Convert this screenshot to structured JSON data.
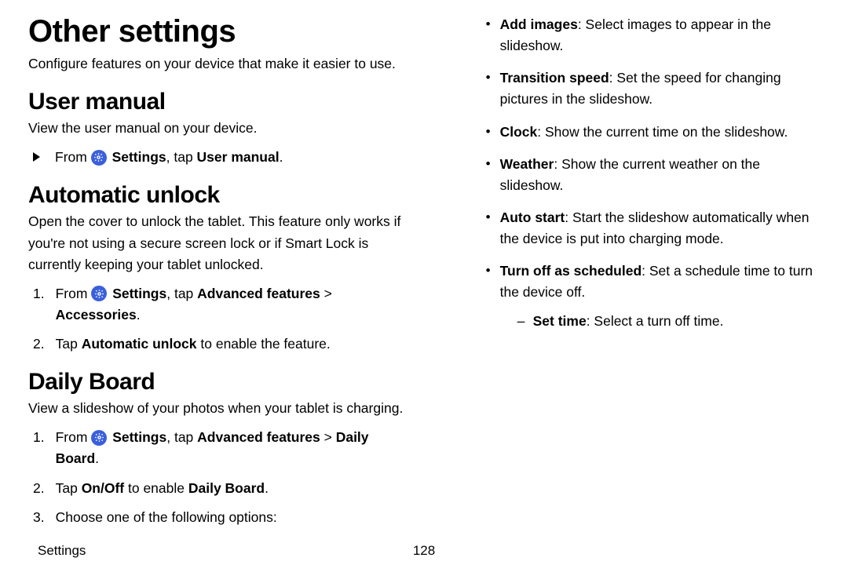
{
  "page": {
    "title": "Other settings",
    "subtitle": "Configure features on your device that make it easier to use.",
    "footer_section": "Settings",
    "footer_page": "128"
  },
  "user_manual": {
    "heading": "User manual",
    "desc": "View the user manual on your device.",
    "step1_pre": "From ",
    "step1_settings": "Settings",
    "step1_mid": ", tap ",
    "step1_target": "User manual",
    "step1_post": "."
  },
  "auto_unlock": {
    "heading": "Automatic unlock",
    "desc": "Open the cover to unlock the tablet. This feature only works if you're not using a secure screen lock or if Smart Lock is currently keeping your tablet unlocked.",
    "s1_num": "1.",
    "s1_pre": "From ",
    "s1_settings": "Settings",
    "s1_mid": ", tap ",
    "s1_feat": "Advanced features",
    "s1_gt": " > ",
    "s1_acc": "Accessories",
    "s1_post": ".",
    "s2_num": "2.",
    "s2_pre": "Tap ",
    "s2_bold": "Automatic unlock",
    "s2_post": " to enable the feature."
  },
  "daily_board": {
    "heading": "Daily Board",
    "desc": "View a slideshow of your photos when your tablet is charging.",
    "s1_num": "1.",
    "s1_pre": "From ",
    "s1_settings": "Settings",
    "s1_mid": ", tap ",
    "s1_feat": "Advanced features",
    "s1_gt": " > ",
    "s1_db": "Daily Board",
    "s1_post": ".",
    "s2_num": "2.",
    "s2_pre": "Tap ",
    "s2_onoff": "On/Off",
    "s2_mid": " to enable ",
    "s2_db": "Daily Board",
    "s2_post": ".",
    "s3_num": "3.",
    "s3_text": "Choose one of the following options:",
    "opts": {
      "add_images_b": "Add images",
      "add_images_t": ": Select images to appear in the slideshow.",
      "transition_b": "Transition speed",
      "transition_t": ": Set the speed for changing pictures in the slideshow.",
      "clock_b": "Clock",
      "clock_t": ": Show the current time on the slideshow.",
      "weather_b": "Weather",
      "weather_t": ": Show the current weather on the slideshow.",
      "autostart_b": "Auto start",
      "autostart_t": ": Start the slideshow automatically when the device is put into charging mode.",
      "turnoff_b": "Turn off as scheduled",
      "turnoff_t": ": Set a schedule time to turn the device off.",
      "settime_b": "Set time",
      "settime_t": ": Select a turn off time."
    }
  }
}
